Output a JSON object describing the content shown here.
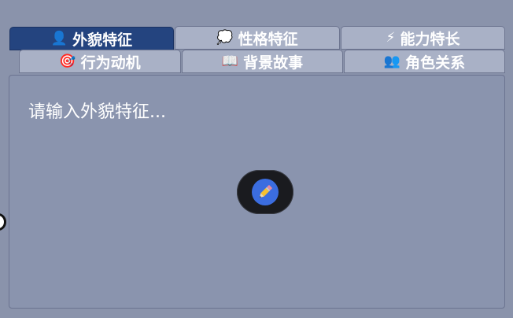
{
  "tabs": [
    {
      "label": "外貌特征",
      "icon": "person-icon",
      "glyph": "👤",
      "active": true
    },
    {
      "label": "性格特征",
      "icon": "thought-bubble-icon",
      "glyph": "💭",
      "active": false
    },
    {
      "label": "能力特长",
      "icon": "lightning-icon",
      "glyph": "⚡",
      "active": false
    },
    {
      "label": "行为动机",
      "icon": "target-icon",
      "glyph": "🎯",
      "active": false
    },
    {
      "label": "背景故事",
      "icon": "book-icon",
      "glyph": "📖",
      "active": false
    },
    {
      "label": "角色关系",
      "icon": "people-icon",
      "glyph": "👥",
      "active": false
    }
  ],
  "editor": {
    "placeholder": "请输入外貌特征...",
    "value": ""
  },
  "fab": {
    "icon": "pencil-icon"
  },
  "colors": {
    "background": "#8a93ab",
    "tab_inactive": "#a9b1c6",
    "tab_active": "#24447f",
    "fab_bg": "#1a1b1f",
    "fab_circle": "#3b6de0"
  }
}
